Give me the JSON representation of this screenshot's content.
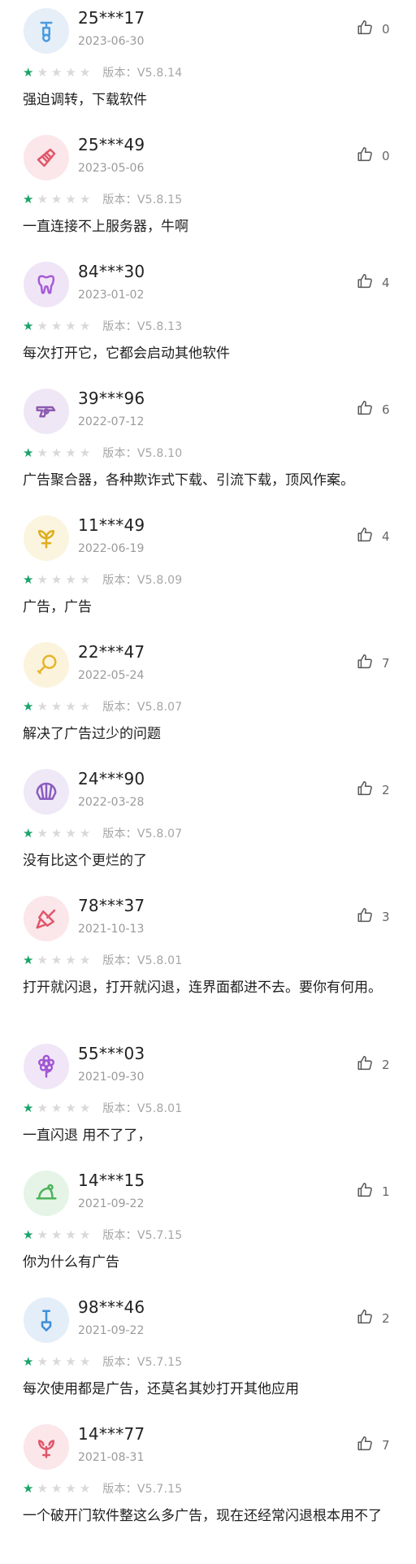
{
  "colors": {
    "star_on": "#1aa36a",
    "star_off": "#d9d9d9"
  },
  "version_prefix": "版本：",
  "reviews": [
    {
      "user": "25***17",
      "date": "2023-06-30",
      "likes": "0",
      "rating": 1,
      "version": "V5.8.14",
      "text": "强迫调转，下载软件",
      "avatar_icon": "scooter-icon",
      "avatar_bg": "#e6eef8",
      "avatar_fg": "#4a9be0"
    },
    {
      "user": "25***49",
      "date": "2023-05-06",
      "likes": "0",
      "rating": 1,
      "version": "V5.8.15",
      "text": "一直连接不上服务器，牛啊",
      "avatar_icon": "comb-icon",
      "avatar_bg": "#fbe7ea",
      "avatar_fg": "#e0566a"
    },
    {
      "user": "84***30",
      "date": "2023-01-02",
      "likes": "4",
      "rating": 1,
      "version": "V5.8.13",
      "text": "每次打开它，它都会启动其他软件",
      "avatar_icon": "tooth-icon",
      "avatar_bg": "#efe5f7",
      "avatar_fg": "#a65bd6"
    },
    {
      "user": "39***96",
      "date": "2022-07-12",
      "likes": "6",
      "rating": 1,
      "version": "V5.8.10",
      "text": "广告聚合器，各种欺诈式下载、引流下载，顶风作案。",
      "avatar_icon": "pistol-icon",
      "avatar_bg": "#efe7f5",
      "avatar_fg": "#8c5bb0"
    },
    {
      "user": "11***49",
      "date": "2022-06-19",
      "likes": "4",
      "rating": 1,
      "version": "V5.8.09",
      "text": "广告，广告",
      "avatar_icon": "plant-icon",
      "avatar_bg": "#fbf4df",
      "avatar_fg": "#e0ad1c"
    },
    {
      "user": "22***47",
      "date": "2022-05-24",
      "likes": "7",
      "rating": 1,
      "version": "V5.8.07",
      "text": "解决了广告过少的问题",
      "avatar_icon": "drumstick-icon",
      "avatar_bg": "#fbf3dc",
      "avatar_fg": "#e6b52a"
    },
    {
      "user": "24***90",
      "date": "2022-03-28",
      "likes": "2",
      "rating": 1,
      "version": "V5.8.07",
      "text": "没有比这个更烂的了",
      "avatar_icon": "shell-icon",
      "avatar_bg": "#efe8f6",
      "avatar_fg": "#8a5cc0"
    },
    {
      "user": "78***37",
      "date": "2021-10-13",
      "likes": "3",
      "rating": 1,
      "version": "V5.8.01",
      "text": "打开就闪退，打开就闪退，连界面都进不去。要你有何用。",
      "avatar_icon": "trowel-icon",
      "avatar_bg": "#fbe6ea",
      "avatar_fg": "#e0566a"
    },
    {
      "user": "55***03",
      "date": "2021-09-30",
      "likes": "2",
      "rating": 1,
      "version": "V5.8.01",
      "text": "一直闪退 用不了了，",
      "avatar_icon": "flower-icon",
      "avatar_bg": "#f0e6f7",
      "avatar_fg": "#a057d2"
    },
    {
      "user": "14***15",
      "date": "2021-09-22",
      "likes": "1",
      "rating": 1,
      "version": "V5.7.15",
      "text": "你为什么有广告",
      "avatar_icon": "hat-icon",
      "avatar_bg": "#e5f4e6",
      "avatar_fg": "#4cb45a"
    },
    {
      "user": "98***46",
      "date": "2021-09-22",
      "likes": "2",
      "rating": 1,
      "version": "V5.7.15",
      "text": "每次使用都是广告，还莫名其妙打开其他应用",
      "avatar_icon": "shovel-icon",
      "avatar_bg": "#e4eef8",
      "avatar_fg": "#3f8ed8"
    },
    {
      "user": "14***77",
      "date": "2021-08-31",
      "likes": "7",
      "rating": 1,
      "version": "V5.7.15",
      "text": "一个破开门软件整这么多广告，现在还经常闪退根本用不了",
      "avatar_icon": "lobster-icon",
      "avatar_bg": "#fbe6ea",
      "avatar_fg": "#e0566a"
    }
  ]
}
